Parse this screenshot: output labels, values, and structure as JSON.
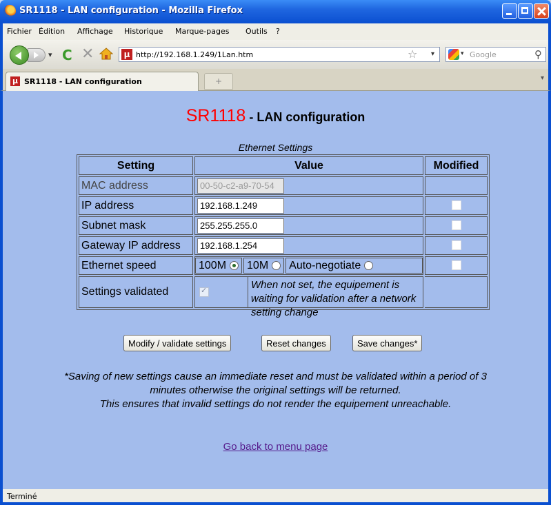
{
  "window": {
    "title": "SR1118 - LAN configuration - Mozilla Firefox"
  },
  "menu": [
    "Fichier",
    "Édition",
    "Affichage",
    "Historique",
    "Marque-pages",
    "Outils",
    "?"
  ],
  "nav": {
    "url": "http://192.168.1.249/1Lan.htm",
    "search_placeholder": "Google"
  },
  "tab": {
    "label": "SR1118 - LAN configuration",
    "newtab": "+"
  },
  "page": {
    "title_brand": "SR1118",
    "title_rest": " - LAN configuration",
    "caption": "Ethernet Settings",
    "headers": {
      "setting": "Setting",
      "value": "Value",
      "modified": "Modified"
    },
    "rows": {
      "mac": {
        "label": "MAC address",
        "value": "00-50-c2-a9-70-54"
      },
      "ip": {
        "label": "IP address",
        "value": "192.168.1.249"
      },
      "subnet": {
        "label": "Subnet mask",
        "value": "255.255.255.0"
      },
      "gateway": {
        "label": "Gateway IP address",
        "value": "192.168.1.254"
      },
      "speed": {
        "label": "Ethernet speed",
        "opt1": "100M",
        "opt2": "10M",
        "opt3": "Auto-negotiate",
        "selected": "100M"
      },
      "validated": {
        "label": "Settings validated",
        "note": "When not set, the equipement is waiting for validation after a network setting change"
      }
    },
    "buttons": {
      "modify": "Modify / validate settings",
      "reset": "Reset changes",
      "save": "Save changes*"
    },
    "footnote_line1": "*Saving of new settings cause an immediate reset and must be validated within a period of 3",
    "footnote_line2": "minutes otherwise the original settings will be returned.",
    "footnote_line3": "This ensures that invalid settings do not render the equipement unreachable.",
    "back_link": "Go back to menu page"
  },
  "status": {
    "text": "Terminé"
  }
}
